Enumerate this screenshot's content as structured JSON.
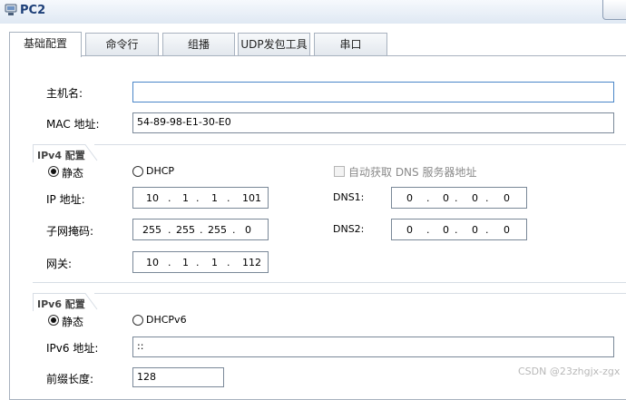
{
  "window": {
    "title": "PC2",
    "icon": "pc-icon"
  },
  "tabs": [
    {
      "label": "基础配置",
      "active": true
    },
    {
      "label": "命令行"
    },
    {
      "label": "组播"
    },
    {
      "label": "UDP发包工具"
    },
    {
      "label": "串口"
    }
  ],
  "basic": {
    "hostname_label": "主机名:",
    "hostname_value": "",
    "mac_label": "MAC 地址:",
    "mac_value": "54-89-98-E1-30-E0"
  },
  "ipv4": {
    "section_title": "IPv4 配置",
    "static_label": "静态",
    "dhcp_label": "DHCP",
    "mode": "static",
    "auto_dns_label": "自动获取 DNS 服务器地址",
    "ip_label": "IP 地址:",
    "ip": [
      "10",
      "1",
      "1",
      "101"
    ],
    "mask_label": "子网掩码:",
    "mask": [
      "255",
      "255",
      "255",
      "0"
    ],
    "gateway_label": "网关:",
    "gateway": [
      "10",
      "1",
      "1",
      "112"
    ],
    "dns1_label": "DNS1:",
    "dns1": [
      "0",
      "0",
      "0",
      "0"
    ],
    "dns2_label": "DNS2:",
    "dns2": [
      "0",
      "0",
      "0",
      "0"
    ]
  },
  "ipv6": {
    "section_title": "IPv6 配置",
    "static_label": "静态",
    "dhcp_label": "DHCPv6",
    "mode": "static",
    "ip_label": "IPv6 地址:",
    "ip_value": "::",
    "prefix_label": "前缀长度:",
    "prefix_value": "128"
  },
  "watermark": "CSDN @23zhgjx-zgx",
  "colors": {
    "title_text": "#1d3f78",
    "focus_border": "#4a86c8",
    "frame": "#a8b2bf"
  }
}
